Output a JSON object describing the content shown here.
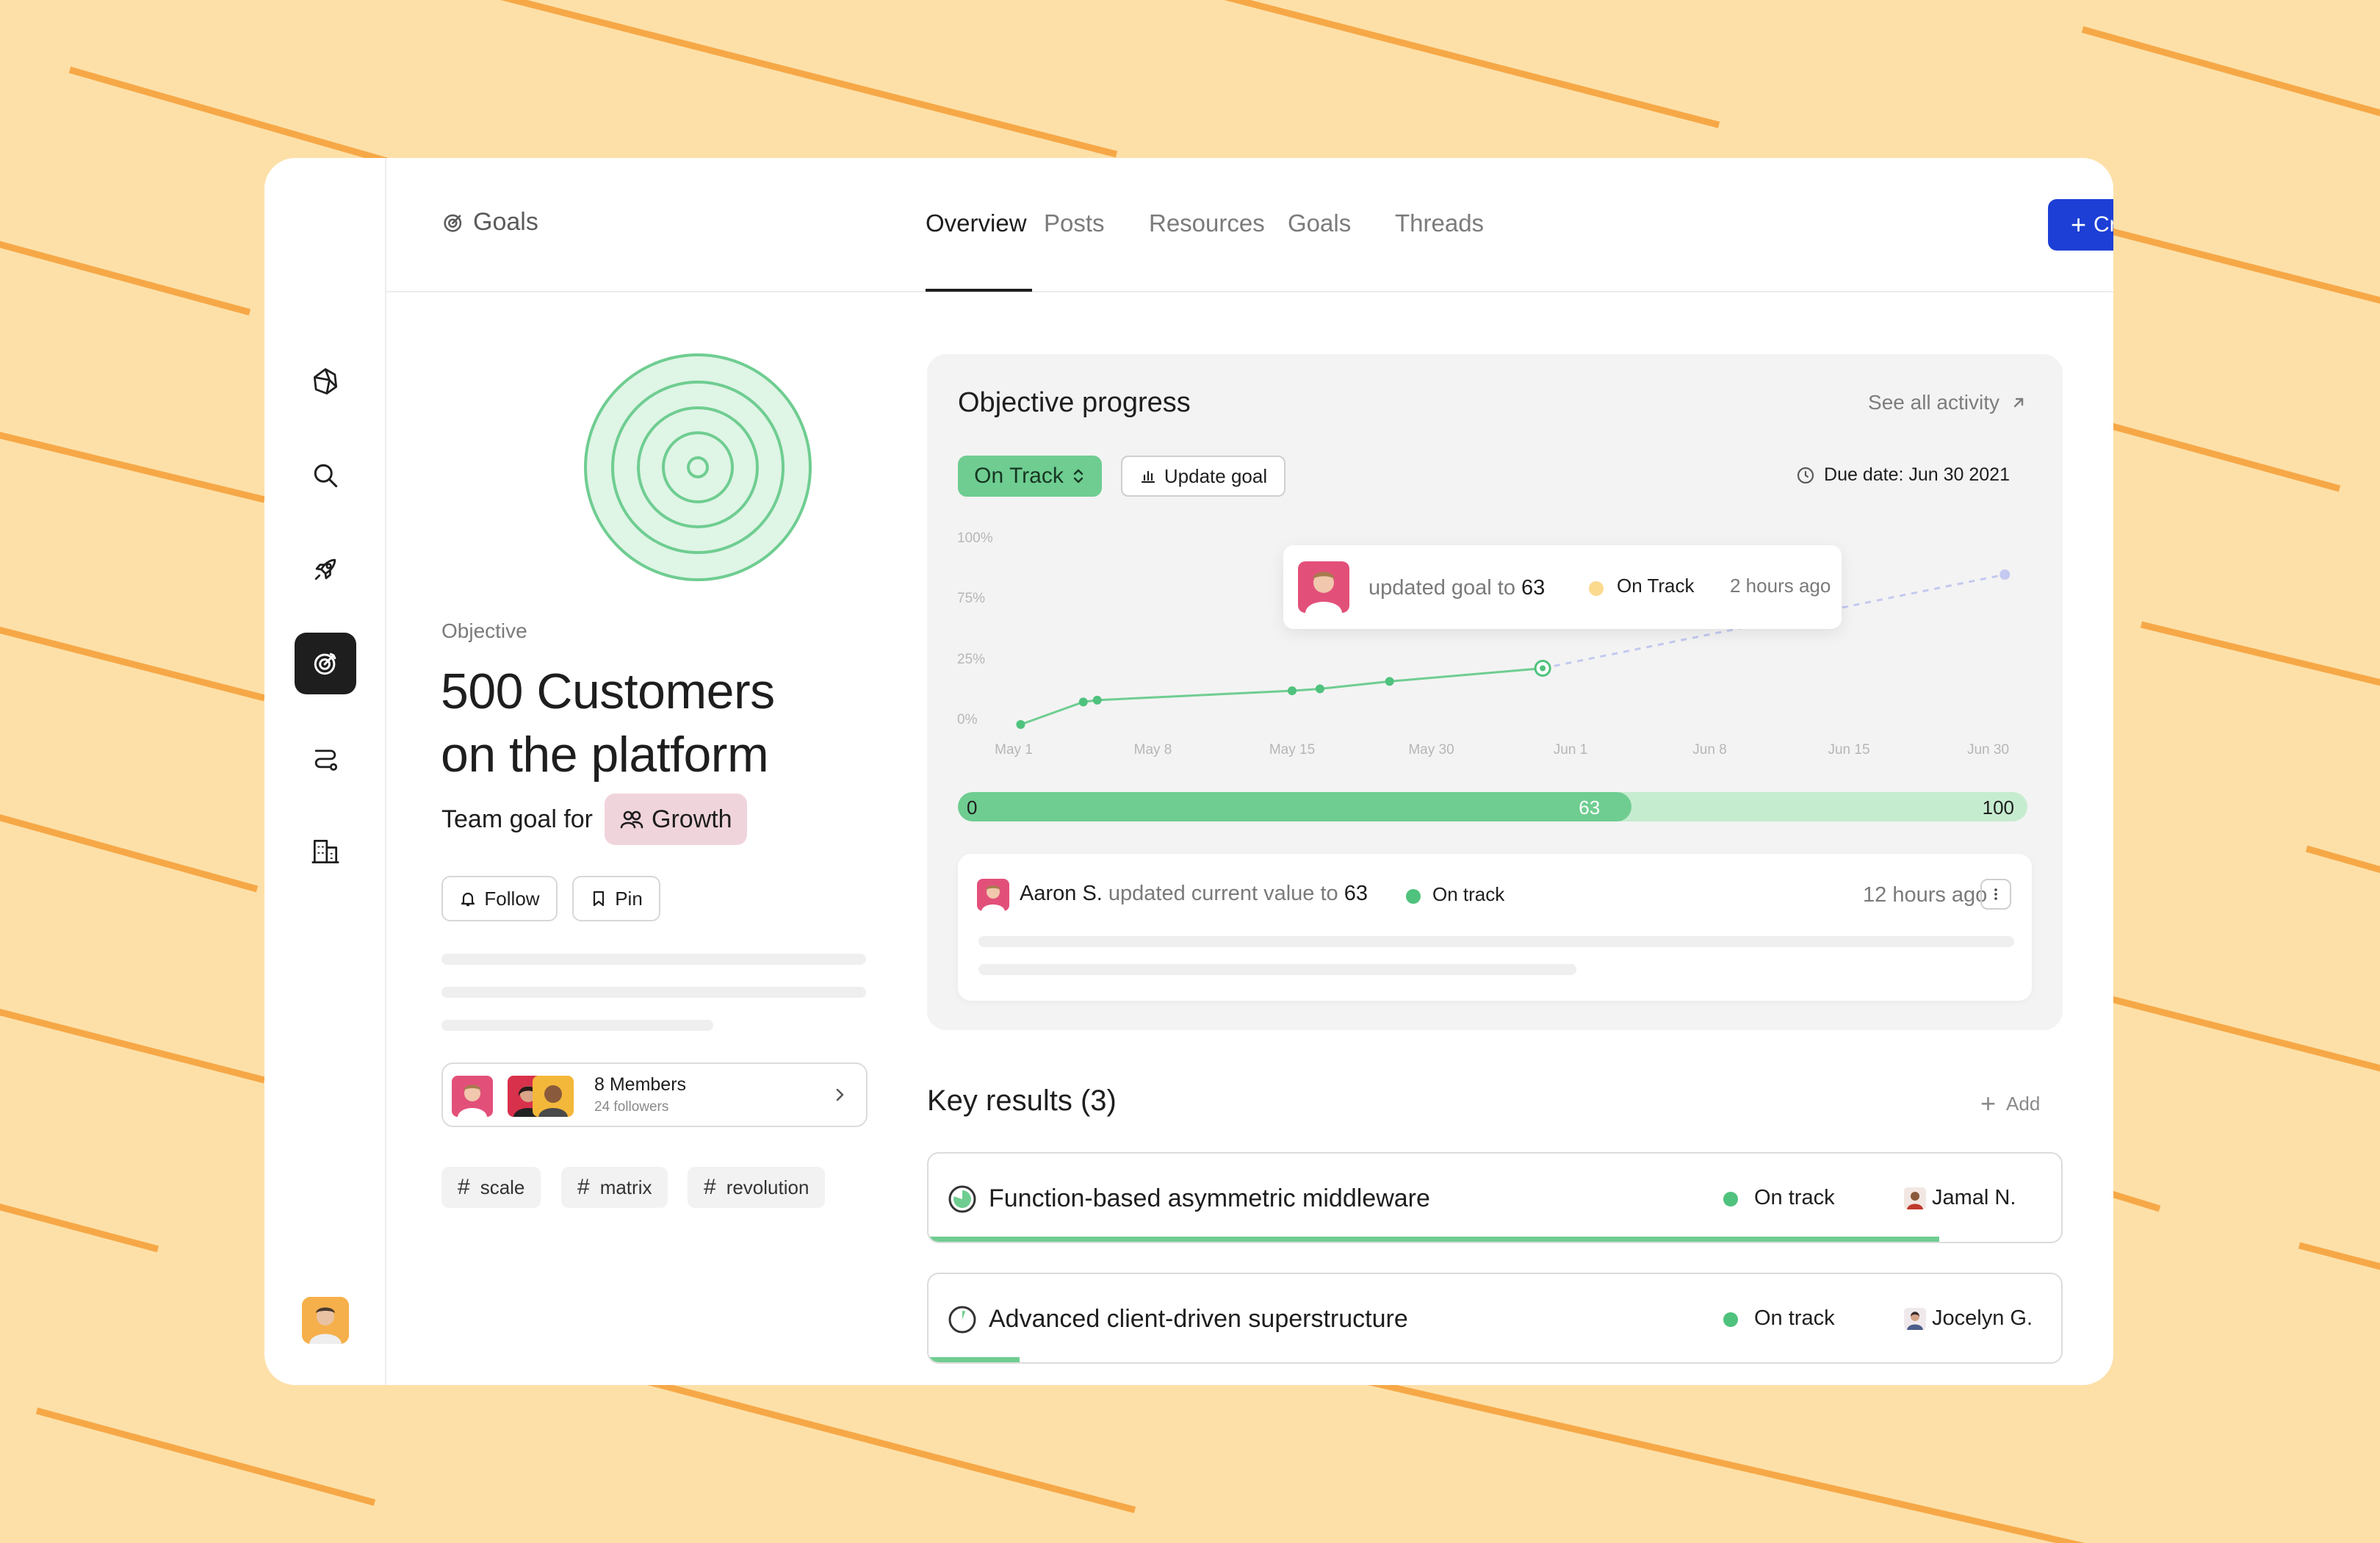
{
  "brand": {
    "accent": "#1d3fd6",
    "green": "#6fcd91",
    "background": "#fde0a8"
  },
  "sidebar": {
    "items": [
      {
        "name": "logo",
        "icon": "cube-logo-icon"
      },
      {
        "name": "search",
        "icon": "search-icon"
      },
      {
        "name": "launch",
        "icon": "rocket-icon"
      },
      {
        "name": "goals",
        "icon": "target-icon",
        "active": true
      },
      {
        "name": "workflow",
        "icon": "route-icon"
      },
      {
        "name": "company",
        "icon": "building-icon"
      }
    ]
  },
  "header": {
    "breadcrumb": "Goals",
    "tabs": [
      {
        "label": "Overview",
        "active": true
      },
      {
        "label": "Posts"
      },
      {
        "label": "Resources"
      },
      {
        "label": "Goals"
      },
      {
        "label": "Threads"
      }
    ],
    "create_label": "Create"
  },
  "objective": {
    "label": "Objective",
    "title_line1": "500 Customers",
    "title_line2": "on the platform",
    "team_prefix": "Team goal for",
    "team": "Growth",
    "follow_label": "Follow",
    "pin_label": "Pin",
    "members": "8 Members",
    "followers": "24 followers",
    "tags": [
      "scale",
      "matrix",
      "revolution"
    ]
  },
  "progress": {
    "title": "Objective progress",
    "see_all": "See all activity",
    "status": "On Track",
    "update_label": "Update goal",
    "due": "Due date: Jun 30 2021",
    "tooltip": {
      "text": "updated goal to",
      "value": "63",
      "status": "On Track",
      "time": "2 hours ago"
    },
    "bar": {
      "start": "0",
      "current": "63",
      "end": "100",
      "fraction": 0.63
    },
    "activity": {
      "name": "Aaron S.",
      "text": "updated current value to",
      "value": "63",
      "status": "On track",
      "time": "12 hours ago"
    }
  },
  "chart_data": {
    "type": "line",
    "x_ticks": [
      "May 1",
      "May 8",
      "May 15",
      "May 30",
      "Jun 1",
      "Jun 8",
      "Jun 15",
      "Jun 30"
    ],
    "y_ticks": [
      "100%",
      "75%",
      "25%",
      "0%"
    ],
    "ylim": [
      0,
      100
    ],
    "series": [
      {
        "points": [
          {
            "x": 0.05,
            "y": 0
          },
          {
            "x": 0.5,
            "y": 12
          },
          {
            "x": 0.6,
            "y": 13
          },
          {
            "x": 2.0,
            "y": 18
          },
          {
            "x": 2.2,
            "y": 19
          },
          {
            "x": 2.7,
            "y": 23
          },
          {
            "x": 3.8,
            "y": 30
          }
        ]
      }
    ],
    "projection": [
      {
        "x": 3.8,
        "y": 30
      },
      {
        "x": 7.12,
        "y": 80
      }
    ],
    "grid": false
  },
  "key_results": {
    "title": "Key results (3)",
    "add_label": "Add",
    "items": [
      {
        "name": "Function-based asymmetric middleware",
        "status": "On track",
        "owner": "Jamal N.",
        "progress": 0.89
      },
      {
        "name": "Advanced client-driven superstructure",
        "status": "On track",
        "owner": "Jocelyn G.",
        "progress": 0.08
      }
    ]
  }
}
